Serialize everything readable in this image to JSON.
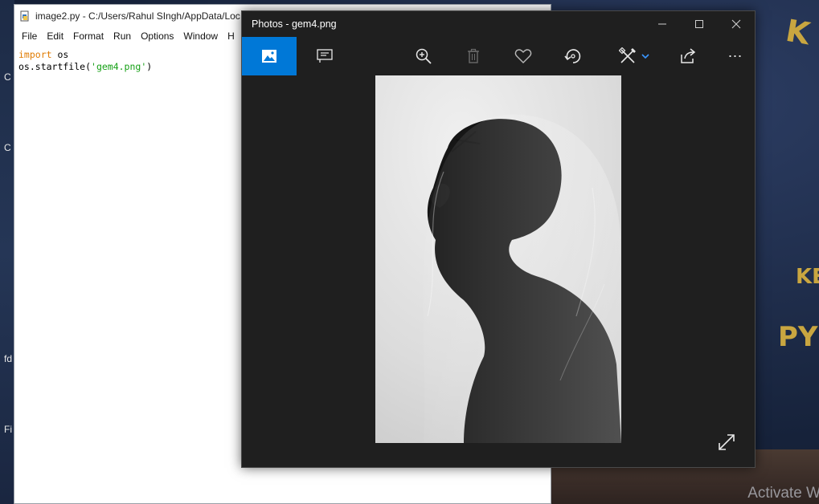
{
  "desktop": {
    "left_labels": [
      "C",
      "C",
      "fd",
      "Fi"
    ],
    "watermark": "Activate W",
    "deco_letters": [
      "K",
      "KE",
      "PY"
    ]
  },
  "idle": {
    "title": "image2.py - C:/Users/Rahul SIngh/AppData/Loc",
    "menus": [
      "File",
      "Edit",
      "Format",
      "Run",
      "Options",
      "Window",
      "H"
    ],
    "code": {
      "line1_keyword": "import",
      "line1_rest": " os",
      "line2_prefix": "os.startfile(",
      "line2_string": "'gem4.png'",
      "line2_suffix": ")"
    }
  },
  "photos": {
    "title": "Photos - gem4.png",
    "controls": {
      "minimize": "minimize-icon",
      "maximize": "maximize-icon",
      "close": "close-icon"
    },
    "toolbar": [
      "collection-icon",
      "slideshow-icon",
      "zoom-icon",
      "delete-icon",
      "favorite-icon",
      "rotate-icon",
      "edit-icon",
      "share-icon",
      "more-icon"
    ],
    "accent": "#0078d7",
    "more_label": "⋯"
  }
}
